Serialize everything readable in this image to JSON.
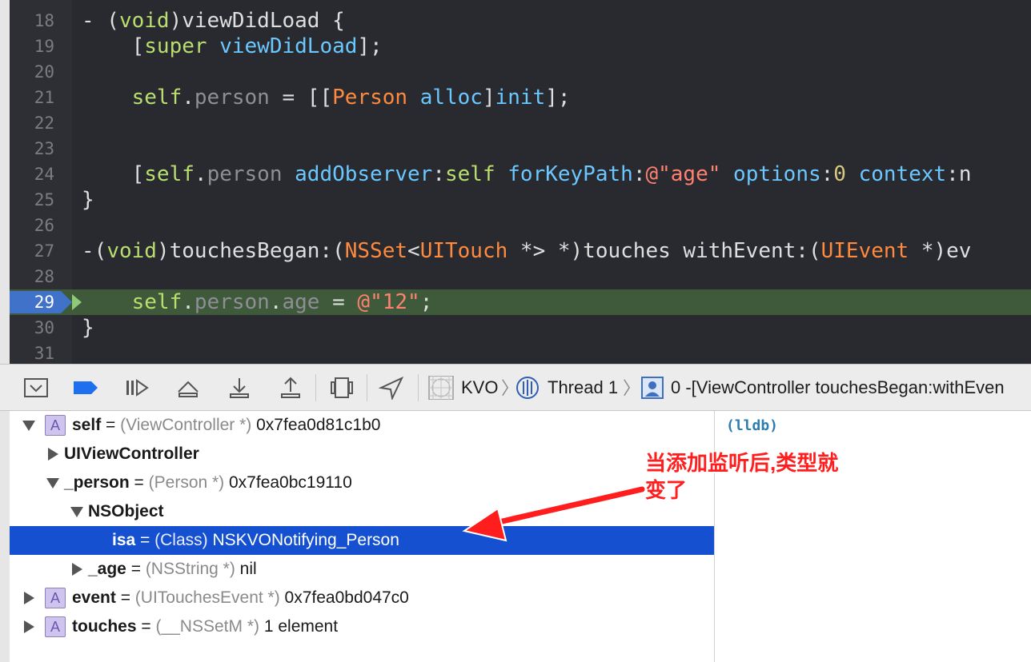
{
  "editor": {
    "lines": [
      {
        "num": "18",
        "tokens": [
          [
            "- (",
            "c-white"
          ],
          [
            "void",
            "c-kw"
          ],
          [
            ")viewDidLoad {",
            "c-white"
          ]
        ]
      },
      {
        "num": "19",
        "tokens": [
          [
            "    [",
            "c-white"
          ],
          [
            "super",
            "c-kw"
          ],
          [
            " ",
            "c-white"
          ],
          [
            "viewDidLoad",
            "c-cyan"
          ],
          [
            "];",
            "c-white"
          ]
        ]
      },
      {
        "num": "20",
        "tokens": []
      },
      {
        "num": "21",
        "tokens": [
          [
            "    ",
            "c-white"
          ],
          [
            "self",
            "c-kw"
          ],
          [
            ".",
            "c-white"
          ],
          [
            "person",
            "c-gray"
          ],
          [
            " = [[",
            "c-white"
          ],
          [
            "Person",
            "c-orange"
          ],
          [
            " ",
            "c-white"
          ],
          [
            "alloc",
            "c-cyan"
          ],
          [
            "]",
            "c-white"
          ],
          [
            "init",
            "c-cyan"
          ],
          [
            "];",
            "c-white"
          ]
        ]
      },
      {
        "num": "22",
        "tokens": []
      },
      {
        "num": "23",
        "tokens": []
      },
      {
        "num": "24",
        "tokens": [
          [
            "    [",
            "c-white"
          ],
          [
            "self",
            "c-kw"
          ],
          [
            ".",
            "c-white"
          ],
          [
            "person",
            "c-gray"
          ],
          [
            " ",
            "c-white"
          ],
          [
            "addObserver",
            "c-cyan"
          ],
          [
            ":",
            "c-white"
          ],
          [
            "self",
            "c-kw"
          ],
          [
            " ",
            "c-white"
          ],
          [
            "forKeyPath",
            "c-cyan"
          ],
          [
            ":",
            "c-white"
          ],
          [
            "@\"age\"",
            "c-str"
          ],
          [
            " ",
            "c-white"
          ],
          [
            "options",
            "c-cyan"
          ],
          [
            ":",
            "c-white"
          ],
          [
            "0",
            "c-num"
          ],
          [
            " ",
            "c-white"
          ],
          [
            "context",
            "c-cyan"
          ],
          [
            ":n",
            "c-white"
          ]
        ]
      },
      {
        "num": "25",
        "tokens": [
          [
            "}",
            "c-white"
          ]
        ]
      },
      {
        "num": "26",
        "tokens": []
      },
      {
        "num": "27",
        "tokens": [
          [
            "-(",
            "c-white"
          ],
          [
            "void",
            "c-kw"
          ],
          [
            ")touchesBegan:(",
            "c-white"
          ],
          [
            "NSSet",
            "c-orange"
          ],
          [
            "<",
            "c-white"
          ],
          [
            "UITouch",
            "c-orange"
          ],
          [
            " *> *)touches withEvent:(",
            "c-white"
          ],
          [
            "UIEvent",
            "c-orange"
          ],
          [
            " *)ev",
            "c-white"
          ]
        ]
      },
      {
        "num": "28",
        "tokens": []
      },
      {
        "num": "29",
        "tokens": [
          [
            "    ",
            "c-white"
          ],
          [
            "self",
            "c-kw"
          ],
          [
            ".",
            "c-white"
          ],
          [
            "person",
            "c-gray"
          ],
          [
            ".",
            "c-white"
          ],
          [
            "age",
            "c-gray"
          ],
          [
            " = ",
            "c-white"
          ],
          [
            "@\"12\"",
            "c-str"
          ],
          [
            ";",
            "c-white"
          ]
        ]
      },
      {
        "num": "30",
        "tokens": [
          [
            "}",
            "c-white"
          ]
        ]
      },
      {
        "num": "31",
        "tokens": []
      }
    ]
  },
  "debug_bar": {
    "icons": [
      "hide-debug-area-icon",
      "breakpoints-toggle-icon",
      "continue-icon",
      "step-over-icon",
      "step-into-icon",
      "step-out-icon",
      "debug-view-hierarchy-icon",
      "simulate-location-icon"
    ],
    "crumb_app": "KVO",
    "crumb_thread": "Thread 1",
    "crumb_frame": "0 -[ViewController touchesBegan:withEven"
  },
  "variables": {
    "self": {
      "name": "self",
      "eq": " = ",
      "type": "(ViewController *)",
      "value": " 0x7fea0d81c1b0"
    },
    "uivc": {
      "name": "UIViewController"
    },
    "person": {
      "name": "_person",
      "eq": " = ",
      "type": "(Person *)",
      "value": " 0x7fea0bc19110"
    },
    "nsobj": {
      "name": "NSObject"
    },
    "isa": {
      "name": "isa",
      "eq": " = ",
      "type": "(Class)",
      "value": " NSKVONotifying_Person"
    },
    "age": {
      "name": "_age",
      "eq": " = ",
      "type": "(NSString *)",
      "value": " nil"
    },
    "event": {
      "name": "event",
      "eq": " = ",
      "type": "(UITouchesEvent *)",
      "value": " 0x7fea0bd047c0"
    },
    "touches": {
      "name": "touches",
      "eq": " = ",
      "type": "(__NSSetM *)",
      "value": " 1 element"
    },
    "a_badge": "A"
  },
  "console": {
    "prompt": "(lldb)"
  },
  "annotation": {
    "line1": "当添加监听后,类型就",
    "line2": "变了"
  },
  "colors": {
    "editor_bg": "#292a30",
    "current_line": "#3f5a3a",
    "selection": "#1450cf",
    "annotation_red": "#ff1d1d"
  }
}
